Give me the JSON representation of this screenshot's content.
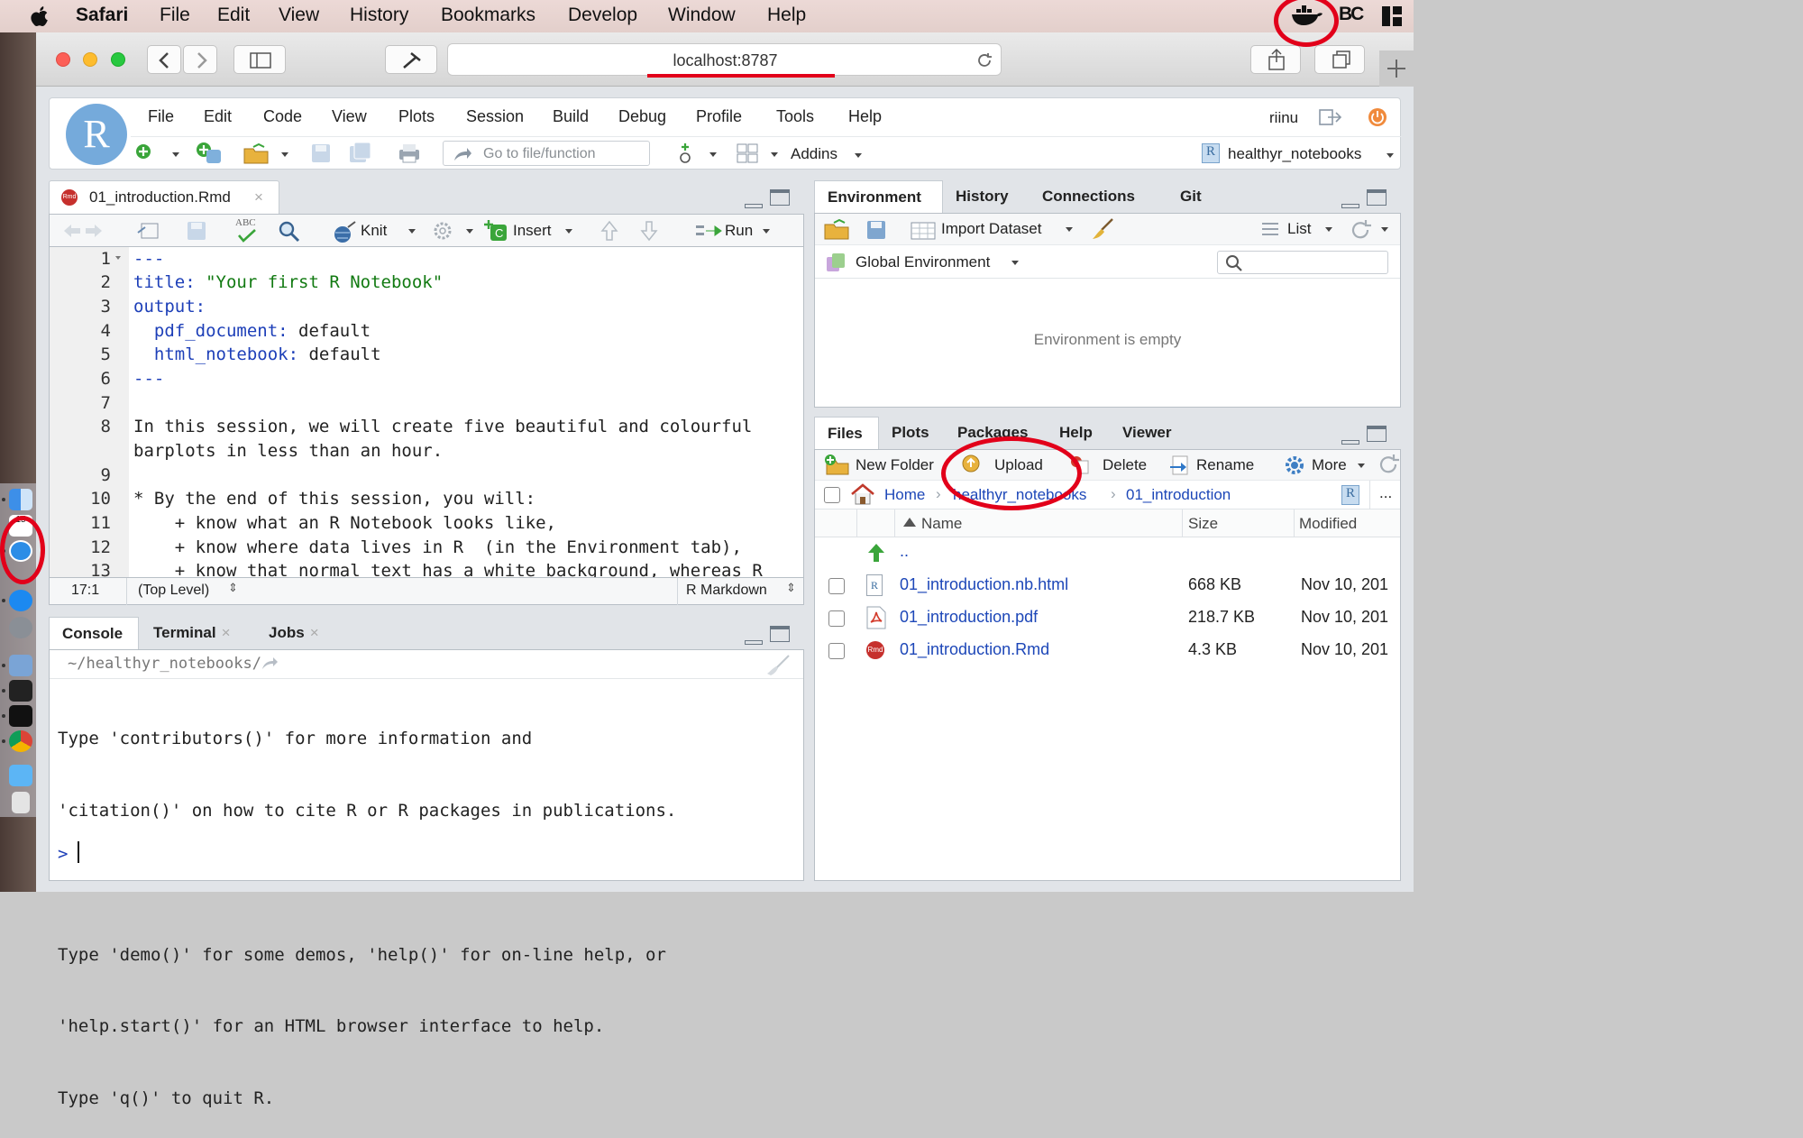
{
  "menubar": {
    "app": "Safari",
    "items": [
      "File",
      "Edit",
      "View",
      "History",
      "Bookmarks",
      "Develop",
      "Window",
      "Help"
    ],
    "right_text": "BC"
  },
  "safari": {
    "url": "localhost:8787"
  },
  "rstudio": {
    "logo_letter": "R",
    "menu": [
      "File",
      "Edit",
      "Code",
      "View",
      "Plots",
      "Session",
      "Build",
      "Debug",
      "Profile",
      "Tools",
      "Help"
    ],
    "user": "riinu",
    "goto_placeholder": "Go to file/function",
    "addins_label": "Addins",
    "project": "healthyr_notebooks",
    "project_icon": "R"
  },
  "editor": {
    "tab_label": "01_introduction.Rmd",
    "toolbar": {
      "knit": "Knit",
      "insert": "Insert",
      "run": "Run",
      "abc": "ABC"
    },
    "line_numbers": [
      "1",
      "2",
      "3",
      "4",
      "5",
      "6",
      "7",
      "8",
      "",
      "9",
      "10",
      "11",
      "12",
      "13"
    ],
    "status": {
      "position": "17:1",
      "scope": "(Top Level)",
      "mode": "R Markdown"
    }
  },
  "console": {
    "tabs": [
      "Console",
      "Terminal",
      "Jobs"
    ],
    "path": "~/healthyr_notebooks/",
    "lines": [
      "Type 'contributors()' for more information and",
      "'citation()' on how to cite R or R packages in publications.",
      "",
      "Type 'demo()' for some demos, 'help()' for on-line help, or",
      "'help.start()' for an HTML browser interface to help.",
      "Type 'q()' to quit R."
    ],
    "prompt": ">"
  },
  "environment": {
    "tabs": [
      "Environment",
      "History",
      "Connections",
      "Git"
    ],
    "import_dataset": "Import Dataset",
    "list_label": "List",
    "scope": "Global Environment",
    "empty_message": "Environment is empty"
  },
  "files": {
    "tabs": [
      "Files",
      "Plots",
      "Packages",
      "Help",
      "Viewer"
    ],
    "toolbar": {
      "new_folder": "New Folder",
      "upload": "Upload",
      "delete": "Delete",
      "rename": "Rename",
      "more": "More"
    },
    "breadcrumb": [
      "Home",
      "healthyr_notebooks",
      "01_introduction"
    ],
    "breadcrumb_icon": "R",
    "ellipsis": "...",
    "columns": {
      "name": "Name",
      "size": "Size",
      "modified": "Modified"
    },
    "up": "..",
    "rows": [
      {
        "name": "01_introduction.nb.html",
        "size": "668 KB",
        "modified": "Nov 10, 201"
      },
      {
        "name": "01_introduction.pdf",
        "size": "218.7 KB",
        "modified": "Nov 10, 201"
      },
      {
        "name": "01_introduction.Rmd",
        "size": "4.3 KB",
        "modified": "Nov 10, 201"
      }
    ],
    "file_badges": [
      "R",
      "",
      "Rmd"
    ]
  },
  "colors": {
    "accent_blue": "#1d47b8",
    "annotation_red": "#e2001a",
    "yaml_green": "#127a12",
    "yaml_blue": "#1d3fb8"
  }
}
